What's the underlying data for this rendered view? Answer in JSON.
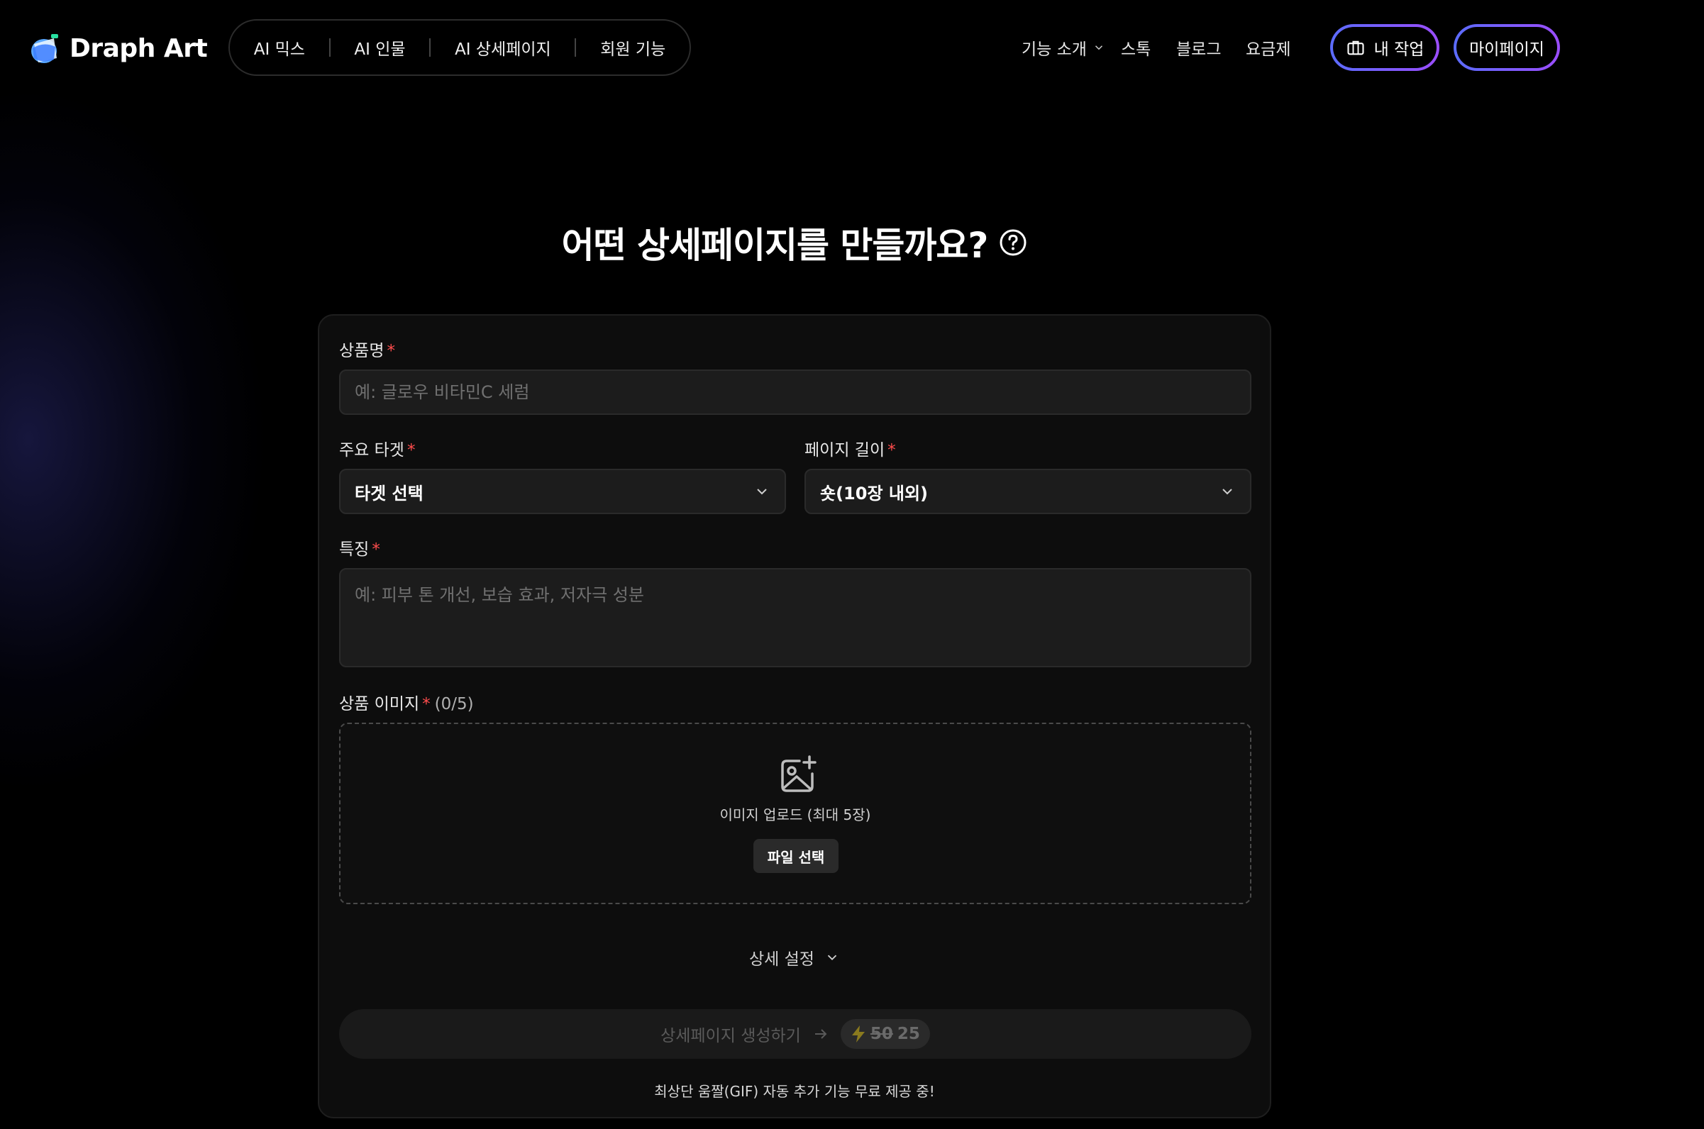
{
  "brand": {
    "name": "Draph Art"
  },
  "top_nav": {
    "items": [
      {
        "label": "AI 믹스"
      },
      {
        "label": "AI 인물"
      },
      {
        "label": "AI 상세페이지"
      },
      {
        "label": "회원 기능"
      }
    ]
  },
  "right_nav": {
    "features": "기능 소개",
    "stock": "스톡",
    "blog": "블로그",
    "pricing": "요금제",
    "my_work": "내 작업",
    "my_page": "마이페이지"
  },
  "page": {
    "title": "어떤 상세페이지를 만들까요?"
  },
  "form": {
    "product_name": {
      "label": "상품명",
      "required": "*",
      "placeholder": "예: 글로우 비타민C 세럼"
    },
    "target": {
      "label": "주요 타겟",
      "required": "*",
      "value": "타겟 선택"
    },
    "page_length": {
      "label": "페이지 길이",
      "required": "*",
      "value": "숏(10장 내외)"
    },
    "features": {
      "label": "특징",
      "required": "*",
      "placeholder": "예: 피부 톤 개선, 보습 효과, 저자극 성분"
    },
    "images": {
      "label": "상품 이미지",
      "required": "*",
      "count": "(0/5)",
      "upload_text": "이미지 업로드 (최대 5장)",
      "file_button": "파일 선택"
    },
    "detail_settings": "상세 설정",
    "generate": {
      "label": "상세페이지 생성하기",
      "credit_old": "50",
      "credit_new": "25"
    },
    "footnote": "최상단 움짤(GIF) 자동 추가 기능 무료 제공 중!"
  },
  "colors": {
    "accent_gradient_start": "#5b6cff",
    "accent_gradient_end": "#9b4dff",
    "required": "#ff4d4d"
  }
}
